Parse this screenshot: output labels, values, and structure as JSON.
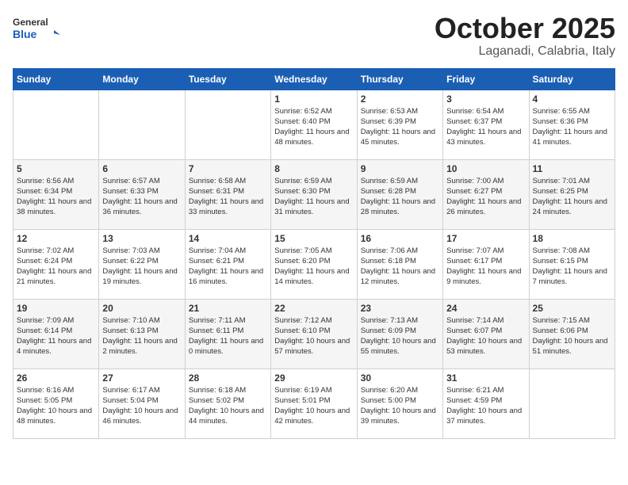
{
  "header": {
    "logo_line1": "General",
    "logo_line2": "Blue",
    "month": "October 2025",
    "location": "Laganadi, Calabria, Italy"
  },
  "weekdays": [
    "Sunday",
    "Monday",
    "Tuesday",
    "Wednesday",
    "Thursday",
    "Friday",
    "Saturday"
  ],
  "weeks": [
    [
      {
        "day": "",
        "text": ""
      },
      {
        "day": "",
        "text": ""
      },
      {
        "day": "",
        "text": ""
      },
      {
        "day": "1",
        "text": "Sunrise: 6:52 AM\nSunset: 6:40 PM\nDaylight: 11 hours and 48 minutes."
      },
      {
        "day": "2",
        "text": "Sunrise: 6:53 AM\nSunset: 6:39 PM\nDaylight: 11 hours and 45 minutes."
      },
      {
        "day": "3",
        "text": "Sunrise: 6:54 AM\nSunset: 6:37 PM\nDaylight: 11 hours and 43 minutes."
      },
      {
        "day": "4",
        "text": "Sunrise: 6:55 AM\nSunset: 6:36 PM\nDaylight: 11 hours and 41 minutes."
      }
    ],
    [
      {
        "day": "5",
        "text": "Sunrise: 6:56 AM\nSunset: 6:34 PM\nDaylight: 11 hours and 38 minutes."
      },
      {
        "day": "6",
        "text": "Sunrise: 6:57 AM\nSunset: 6:33 PM\nDaylight: 11 hours and 36 minutes."
      },
      {
        "day": "7",
        "text": "Sunrise: 6:58 AM\nSunset: 6:31 PM\nDaylight: 11 hours and 33 minutes."
      },
      {
        "day": "8",
        "text": "Sunrise: 6:59 AM\nSunset: 6:30 PM\nDaylight: 11 hours and 31 minutes."
      },
      {
        "day": "9",
        "text": "Sunrise: 6:59 AM\nSunset: 6:28 PM\nDaylight: 11 hours and 28 minutes."
      },
      {
        "day": "10",
        "text": "Sunrise: 7:00 AM\nSunset: 6:27 PM\nDaylight: 11 hours and 26 minutes."
      },
      {
        "day": "11",
        "text": "Sunrise: 7:01 AM\nSunset: 6:25 PM\nDaylight: 11 hours and 24 minutes."
      }
    ],
    [
      {
        "day": "12",
        "text": "Sunrise: 7:02 AM\nSunset: 6:24 PM\nDaylight: 11 hours and 21 minutes."
      },
      {
        "day": "13",
        "text": "Sunrise: 7:03 AM\nSunset: 6:22 PM\nDaylight: 11 hours and 19 minutes."
      },
      {
        "day": "14",
        "text": "Sunrise: 7:04 AM\nSunset: 6:21 PM\nDaylight: 11 hours and 16 minutes."
      },
      {
        "day": "15",
        "text": "Sunrise: 7:05 AM\nSunset: 6:20 PM\nDaylight: 11 hours and 14 minutes."
      },
      {
        "day": "16",
        "text": "Sunrise: 7:06 AM\nSunset: 6:18 PM\nDaylight: 11 hours and 12 minutes."
      },
      {
        "day": "17",
        "text": "Sunrise: 7:07 AM\nSunset: 6:17 PM\nDaylight: 11 hours and 9 minutes."
      },
      {
        "day": "18",
        "text": "Sunrise: 7:08 AM\nSunset: 6:15 PM\nDaylight: 11 hours and 7 minutes."
      }
    ],
    [
      {
        "day": "19",
        "text": "Sunrise: 7:09 AM\nSunset: 6:14 PM\nDaylight: 11 hours and 4 minutes."
      },
      {
        "day": "20",
        "text": "Sunrise: 7:10 AM\nSunset: 6:13 PM\nDaylight: 11 hours and 2 minutes."
      },
      {
        "day": "21",
        "text": "Sunrise: 7:11 AM\nSunset: 6:11 PM\nDaylight: 11 hours and 0 minutes."
      },
      {
        "day": "22",
        "text": "Sunrise: 7:12 AM\nSunset: 6:10 PM\nDaylight: 10 hours and 57 minutes."
      },
      {
        "day": "23",
        "text": "Sunrise: 7:13 AM\nSunset: 6:09 PM\nDaylight: 10 hours and 55 minutes."
      },
      {
        "day": "24",
        "text": "Sunrise: 7:14 AM\nSunset: 6:07 PM\nDaylight: 10 hours and 53 minutes."
      },
      {
        "day": "25",
        "text": "Sunrise: 7:15 AM\nSunset: 6:06 PM\nDaylight: 10 hours and 51 minutes."
      }
    ],
    [
      {
        "day": "26",
        "text": "Sunrise: 6:16 AM\nSunset: 5:05 PM\nDaylight: 10 hours and 48 minutes."
      },
      {
        "day": "27",
        "text": "Sunrise: 6:17 AM\nSunset: 5:04 PM\nDaylight: 10 hours and 46 minutes."
      },
      {
        "day": "28",
        "text": "Sunrise: 6:18 AM\nSunset: 5:02 PM\nDaylight: 10 hours and 44 minutes."
      },
      {
        "day": "29",
        "text": "Sunrise: 6:19 AM\nSunset: 5:01 PM\nDaylight: 10 hours and 42 minutes."
      },
      {
        "day": "30",
        "text": "Sunrise: 6:20 AM\nSunset: 5:00 PM\nDaylight: 10 hours and 39 minutes."
      },
      {
        "day": "31",
        "text": "Sunrise: 6:21 AM\nSunset: 4:59 PM\nDaylight: 10 hours and 37 minutes."
      },
      {
        "day": "",
        "text": ""
      }
    ]
  ]
}
